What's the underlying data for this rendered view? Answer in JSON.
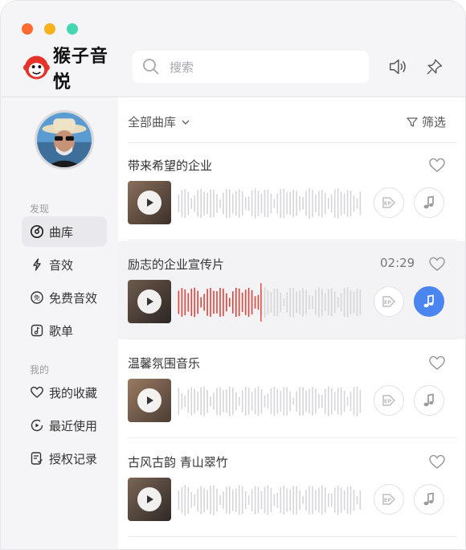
{
  "app": {
    "name": "猴子音悦"
  },
  "window_controls": {
    "close_color": "#ff6a2f",
    "minimize_color": "#f5b21a",
    "maximize_color": "#47d6b2"
  },
  "search": {
    "placeholder": "搜索"
  },
  "header_buttons": {
    "volume_icon": "volume-icon",
    "pin_icon": "pin-icon"
  },
  "sidebar": {
    "discover_title": "发现",
    "discover_items": [
      {
        "label": "曲库",
        "icon": "disc-icon",
        "active": true
      },
      {
        "label": "音效",
        "icon": "bolt-icon"
      },
      {
        "label": "免费音效",
        "icon": "free-icon"
      },
      {
        "label": "歌单",
        "icon": "playlist-icon"
      }
    ],
    "mine_title": "我的",
    "mine_items": [
      {
        "label": "我的收藏",
        "icon": "heart-icon"
      },
      {
        "label": "最近使用",
        "icon": "recent-icon"
      },
      {
        "label": "授权记录",
        "icon": "license-icon"
      }
    ]
  },
  "toolbar": {
    "library_label": "全部曲库",
    "filter_label": "筛选"
  },
  "tracks": [
    {
      "title": "带来希望的企业",
      "time": "",
      "active": false,
      "progress": 0
    },
    {
      "title": "励志的企业宣传片",
      "time": "02:29",
      "active": true,
      "progress": 0.45
    },
    {
      "title": "温馨氛围音乐",
      "time": "",
      "active": false,
      "progress": 0
    },
    {
      "title": "古风古韵 青山翠竹",
      "time": "",
      "active": false,
      "progress": 0
    }
  ],
  "colors": {
    "accent": "#4b86f0",
    "played": "#e3433a",
    "wave": "#d6d6da"
  }
}
